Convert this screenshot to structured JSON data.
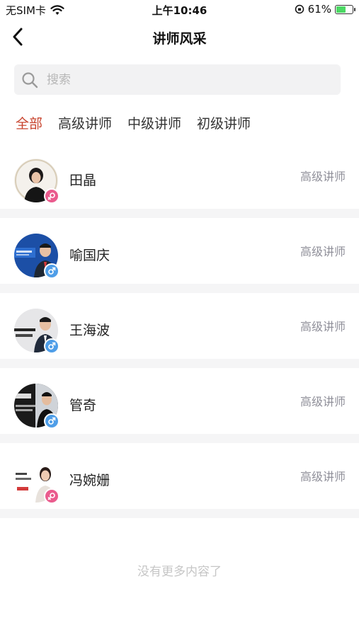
{
  "status_bar": {
    "carrier": "无SIM卡",
    "time": "上午10:46",
    "battery": "61%",
    "battery_level": 0.61,
    "wifi_icon": "wifi-icon",
    "lock_icon": "orientation-lock-icon"
  },
  "nav": {
    "title": "讲师风采",
    "back_icon": "chevron-left-icon"
  },
  "search": {
    "placeholder": "搜索",
    "value": ""
  },
  "tabs": [
    {
      "label": "全部",
      "active": true
    },
    {
      "label": "高级讲师",
      "active": false
    },
    {
      "label": "中级讲师",
      "active": false
    },
    {
      "label": "初级讲师",
      "active": false
    }
  ],
  "lecturers": [
    {
      "name": "田晶",
      "level": "高级讲师",
      "gender": "female"
    },
    {
      "name": "喻国庆",
      "level": "高级讲师",
      "gender": "male"
    },
    {
      "name": "王海波",
      "level": "高级讲师",
      "gender": "male"
    },
    {
      "name": "管奇",
      "level": "高级讲师",
      "gender": "male"
    },
    {
      "name": "冯婉姗",
      "level": "高级讲师",
      "gender": "female"
    }
  ],
  "end_text": "没有更多内容了",
  "colors": {
    "accent": "#c8452f",
    "female_badge": "#ea5b8d",
    "male_badge": "#4f9ee8",
    "level_text": "#8f8f99"
  }
}
